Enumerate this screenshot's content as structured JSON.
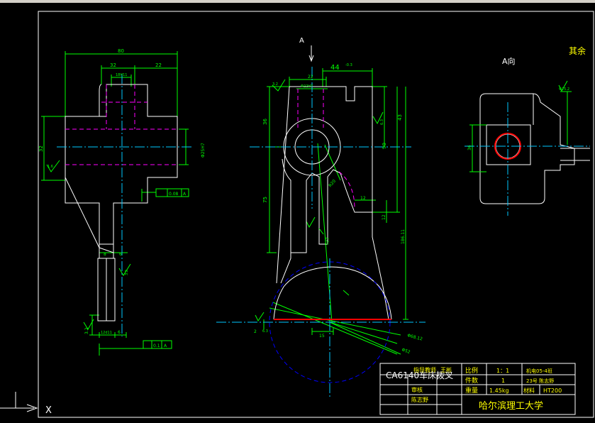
{
  "app": {
    "window": "AutoCAD drawing",
    "ucs_axis_label": "X"
  },
  "colors": {
    "background": "#000000",
    "outline": "#ffffff",
    "dimension": "#00ff00",
    "centerline": "#00c8ff",
    "hidden": "#ff00ff",
    "section": "#ff0000",
    "circle_ref": "#0000ff",
    "note": "#ffff00",
    "hatch": "#00ff00"
  },
  "views": {
    "left": {
      "dims": [
        "80",
        "32",
        "22",
        "18H11",
        "Φ25H7",
        "32",
        "1.6",
        "0.08",
        "A",
        "8",
        "6",
        "3.2",
        "12d11",
        "6",
        "0.1",
        "A",
        "3.2"
      ]
    },
    "center": {
      "arrow_label": "A",
      "dims": [
        "44",
        "-0.3",
        "22",
        "Φ22H7",
        "3.2",
        "36",
        "43",
        "90",
        "75",
        "R20",
        "12",
        "12",
        "6.3",
        "186.11",
        "127",
        "15",
        "2",
        "6.3",
        "Φ68.12",
        "Φ52"
      ]
    },
    "right": {
      "view_title": "A向",
      "dims": [
        "Φ25.2",
        "36"
      ]
    },
    "note_text": "其余"
  },
  "title_block": {
    "drawing_name": "CA6140车床拨叉",
    "rows": [
      {
        "label": "指导教师",
        "value": "王彬"
      },
      {
        "label": "审核",
        "value": ""
      },
      {
        "label": "",
        "value": "陈志野"
      }
    ],
    "scale_label": "比例",
    "scale_value": "1：1",
    "count_label": "件数",
    "count_value": "1",
    "weight_label": "重量",
    "weight_value": "1.45kg",
    "material_label": "材料",
    "material_value": "HT200",
    "class_value": "机电05-4班",
    "student_value": "23号  陈志野",
    "school": "哈尔滨理工大学"
  }
}
